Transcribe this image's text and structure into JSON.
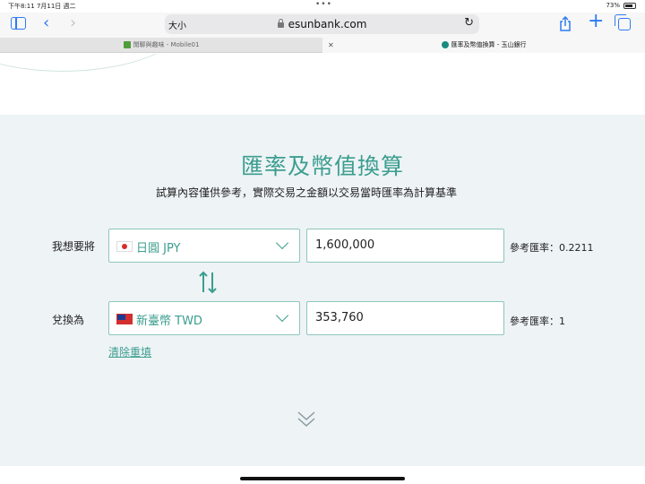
{
  "status_bar": {
    "time_date": "下午8:11  7月11日 週二",
    "dots": "•••",
    "battery": "73%"
  },
  "toolbar": {
    "text_size_label": "大小",
    "url": "esunbank.com",
    "reload_glyph": "↻",
    "back_glyph": "‹",
    "forward_glyph": "›",
    "share_glyph": "⇪",
    "plus_glyph": "+"
  },
  "tabs": [
    {
      "label": "閒聊與趣味 - Mobile01"
    },
    {
      "label": "匯率及幣值換算 - 玉山銀行",
      "close": "✕"
    }
  ],
  "converter": {
    "title": "匯率及幣值換算",
    "subtitle": "試算內容僅供參考，實際交易之金額以交易當時匯率為計算基準",
    "from": {
      "label": "我想要將",
      "currency": "日圓 JPY",
      "amount": "1,600,000",
      "rate_text": "參考匯率：0.2211"
    },
    "to": {
      "label": "兌換為",
      "currency": "新臺幣 TWD",
      "amount": "353,760",
      "rate_text": "參考匯率：1"
    },
    "clear_label": "清除重填"
  },
  "colors": {
    "accent": "#3b9e8f",
    "section_bg": "#eef3f6",
    "link_blue": "#2f7bf5"
  }
}
